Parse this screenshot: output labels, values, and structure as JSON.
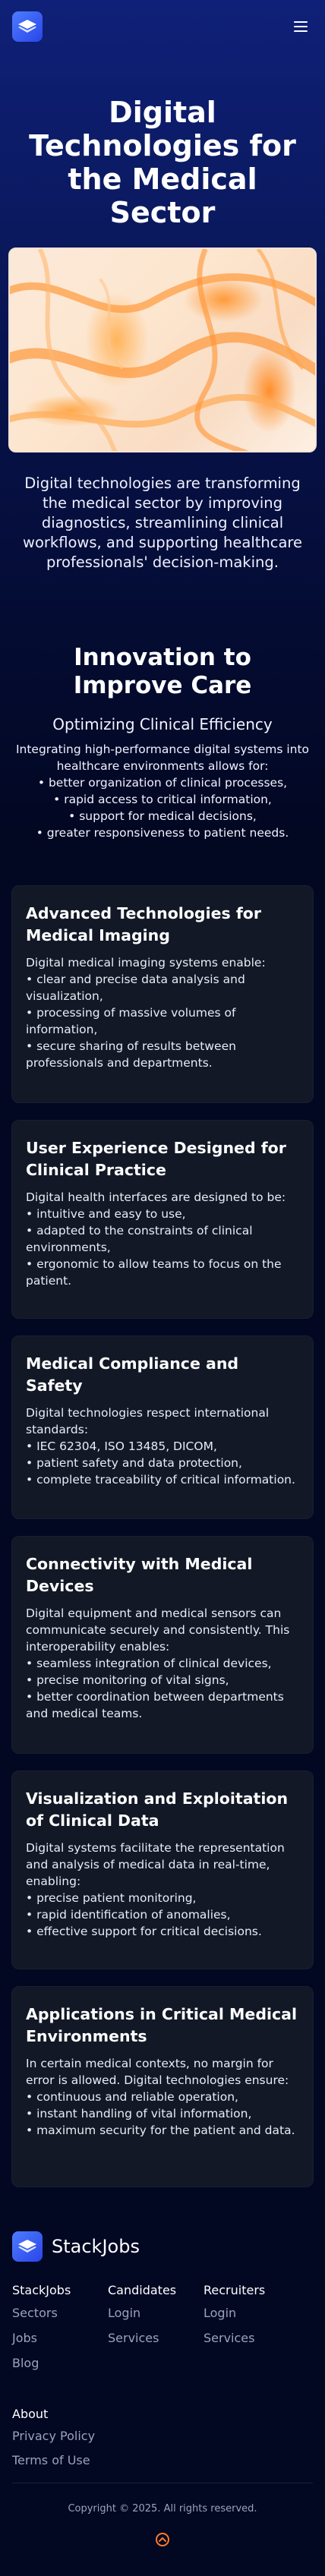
{
  "header": {
    "logo_icon": "stackjobs-logo-icon",
    "menu_icon": "hamburger-menu-icon"
  },
  "hero": {
    "title": "Digital Technologies for the Medical Sector",
    "text": "Digital technologies are transforming the medical sector by improving diagnostics, streamlining clinical workflows, and supporting healthcare professionals' decision-making."
  },
  "innovation": {
    "title": "Innovation to Improve Care",
    "subtitle": "Optimizing Clinical Efficiency",
    "intro_lines": [
      "Integrating high-performance digital systems into healthcare environments allows for:",
      "• better organization of clinical processes,",
      "• rapid access to critical information,",
      "• support for medical decisions,",
      "• greater responsiveness to patient needs."
    ]
  },
  "cards": [
    {
      "title": "Advanced Technologies for Medical Imaging",
      "lines": [
        "Digital medical imaging systems enable:",
        "• clear and precise data analysis and visualization,",
        "• processing of massive volumes of information,",
        "• secure sharing of results between professionals and departments."
      ]
    },
    {
      "title": "User Experience Designed for Clinical Practice",
      "lines": [
        "Digital health interfaces are designed to be:",
        "• intuitive and easy to use,",
        "• adapted to the constraints of clinical environments,",
        "• ergonomic to allow teams to focus on the patient."
      ]
    },
    {
      "title": "Medical Compliance and Safety",
      "lines": [
        "Digital technologies respect international standards:",
        "• IEC 62304, ISO 13485, DICOM,",
        "• patient safety and data protection,",
        "• complete traceability of critical information."
      ]
    },
    {
      "title": "Connectivity with Medical Devices",
      "lines": [
        "Digital equipment and medical sensors can communicate securely and consistently. This interoperability enables:",
        "• seamless integration of clinical devices,",
        "• precise monitoring of vital signs,",
        "• better coordination between departments and medical teams."
      ]
    },
    {
      "title": "Visualization and Exploitation of Clinical Data",
      "lines": [
        "Digital systems facilitate the representation and analysis of medical data in real-time, enabling:",
        "• precise patient monitoring,",
        "• rapid identification of anomalies,",
        "• effective support for critical decisions."
      ]
    },
    {
      "title": "Applications in Critical Medical Environments",
      "lines": [
        "In certain medical contexts, no margin for error is allowed. Digital technologies ensure:",
        "• continuous and reliable operation,",
        "• instant handling of vital information,",
        "• maximum security for the patient and data."
      ]
    }
  ],
  "footer": {
    "brand": "StackJobs",
    "columns": [
      {
        "head": "StackJobs",
        "links": [
          "Sectors",
          "Jobs",
          "Blog"
        ]
      },
      {
        "head": "Candidates",
        "links": [
          "Login",
          "Services"
        ]
      },
      {
        "head": "Recruiters",
        "links": [
          "Login",
          "Services"
        ]
      }
    ],
    "about": {
      "head": "About",
      "links": [
        "Privacy Policy",
        "Terms of Use"
      ]
    },
    "copyright": "Copyright © 2025. All rights reserved.",
    "scroll_top_icon": "scroll-to-top-icon"
  },
  "colors": {
    "accent": "#3b5bff",
    "card_bg": "#121826",
    "footer_link": "#9aa3b8",
    "scroll_top": "#ff7a2a"
  }
}
